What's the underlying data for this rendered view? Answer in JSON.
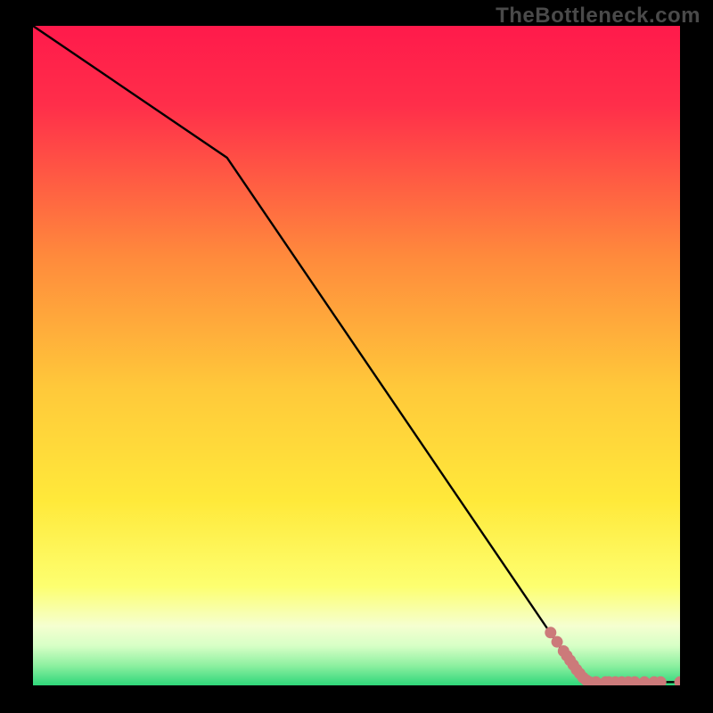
{
  "watermark": "TheBottleneck.com",
  "colors": {
    "frame_bg": "#000000",
    "line": "#000000",
    "marker_fill": "#cc7a7a",
    "marker_stroke": "#cc7a7a",
    "watermark": "#4a4a4a",
    "gradient_top": "#ff1a4b",
    "gradient_yellow": "#ffe93a",
    "gradient_pale": "#f5ffd0",
    "gradient_green": "#2fd67a"
  },
  "chart_data": {
    "type": "line",
    "title": "",
    "xlabel": "",
    "ylabel": "",
    "xlim": [
      0,
      100
    ],
    "ylim": [
      0,
      100
    ],
    "series": [
      {
        "name": "curve",
        "x": [
          0,
          30,
          82,
          86,
          100
        ],
        "y": [
          100,
          80,
          5,
          0.5,
          0.5
        ]
      }
    ],
    "markers": {
      "name": "highlight-points",
      "x": [
        80,
        81,
        82,
        82.5,
        83,
        83.5,
        84,
        84.5,
        85,
        85.5,
        86,
        87,
        88.5,
        89,
        90,
        91,
        92,
        93,
        94.5,
        96,
        97,
        100
      ],
      "y": [
        8,
        6.6,
        5.2,
        4.5,
        3.8,
        3.1,
        2.4,
        1.8,
        1.2,
        0.8,
        0.5,
        0.5,
        0.5,
        0.5,
        0.5,
        0.5,
        0.5,
        0.5,
        0.5,
        0.5,
        0.5,
        0.5
      ]
    },
    "background_gradient": {
      "stops": [
        {
          "offset": 0.0,
          "color": "#ff1a4b"
        },
        {
          "offset": 0.12,
          "color": "#ff2e4a"
        },
        {
          "offset": 0.35,
          "color": "#ff8a3c"
        },
        {
          "offset": 0.55,
          "color": "#ffc93a"
        },
        {
          "offset": 0.72,
          "color": "#ffe93a"
        },
        {
          "offset": 0.85,
          "color": "#fdff70"
        },
        {
          "offset": 0.91,
          "color": "#f5ffd0"
        },
        {
          "offset": 0.94,
          "color": "#d7ffc6"
        },
        {
          "offset": 0.97,
          "color": "#8df0a0"
        },
        {
          "offset": 1.0,
          "color": "#2fd67a"
        }
      ]
    }
  }
}
